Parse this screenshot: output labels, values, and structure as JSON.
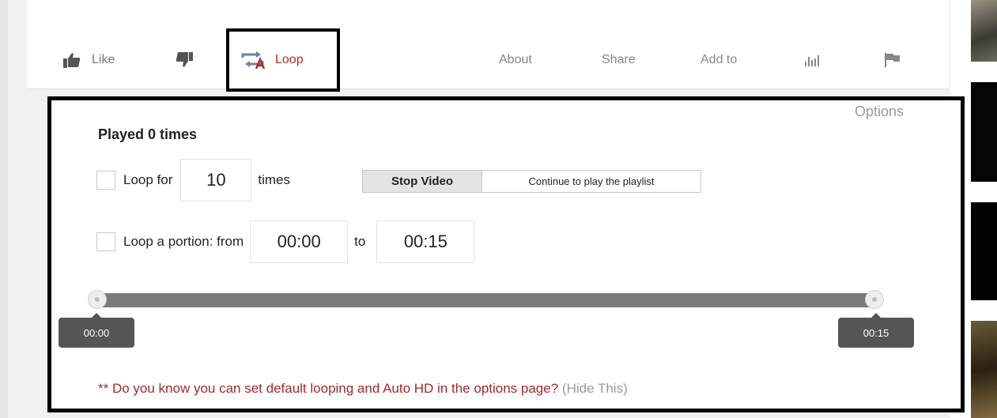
{
  "actions": {
    "like_label": "Like",
    "loop_label": "Loop",
    "about_label": "About",
    "share_label": "Share",
    "addto_label": "Add to"
  },
  "icons": {
    "like": "thumbs-up-icon",
    "dislike": "thumbs-down-icon",
    "loop": "loop-icon",
    "stats": "stats-bar-icon",
    "flag": "flag-icon"
  },
  "colors": {
    "accent_red": "#b52b27",
    "muted_text": "#888888",
    "tooltip_bg": "#555555"
  },
  "panel": {
    "options_label": "Options",
    "played_text": "Played 0 times",
    "loop_for_label": "Loop for",
    "loop_count": "10",
    "times_label": "times",
    "stop_video_label": "Stop Video",
    "continue_label": "Continue to play the playlist",
    "loop_portion_label": "Loop a portion: from",
    "from_time": "00:00",
    "to_label": "to",
    "to_time": "00:15",
    "slider_start_label": "00:00",
    "slider_end_label": "00:15",
    "notice_text": "** Do you know you can set default looping and Auto HD in the options page?",
    "hide_label": "(Hide This)"
  }
}
